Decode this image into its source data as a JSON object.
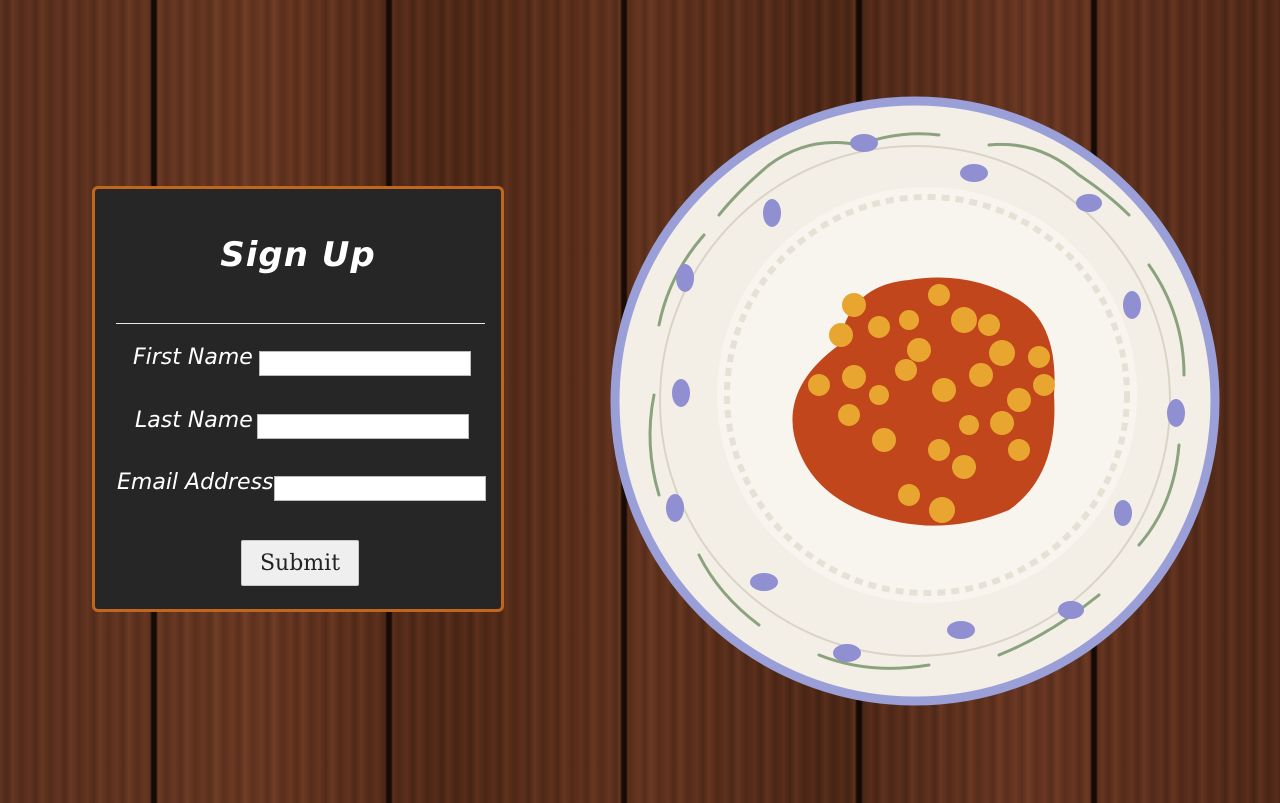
{
  "form": {
    "title": "Sign Up",
    "fields": [
      {
        "label": "First Name",
        "value": "",
        "placeholder": ""
      },
      {
        "label": "Last Name",
        "value": "",
        "placeholder": ""
      },
      {
        "label": "Email Address",
        "value": "",
        "placeholder": ""
      }
    ],
    "submit_label": "Submit"
  },
  "colors": {
    "card_background": "#262626",
    "card_border": "#c0661e",
    "wood": "#5a3020",
    "plate_rim": "#9a9fd8",
    "curry": "#c1461c",
    "chickpea": "#e8a630"
  },
  "image": {
    "subject": "plate-of-chickpea-curry-with-rice"
  }
}
